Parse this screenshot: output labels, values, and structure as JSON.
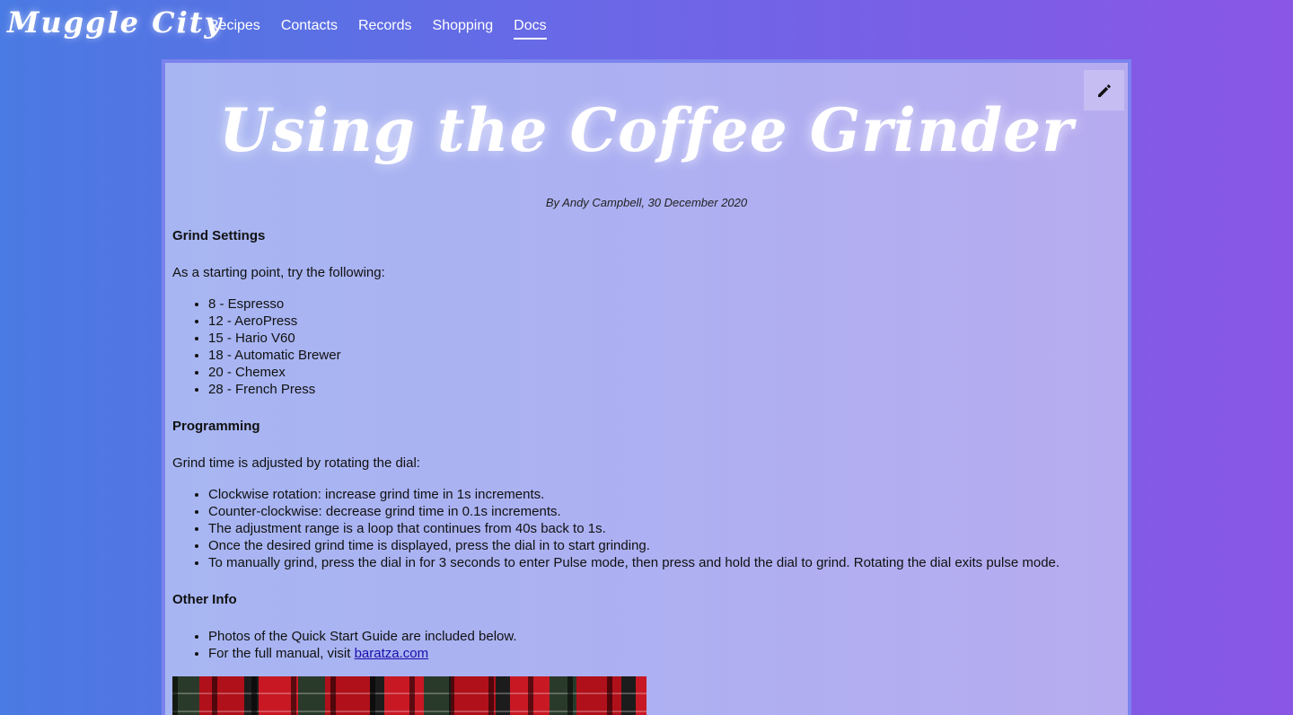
{
  "brand": "Muggle City",
  "nav": {
    "items": [
      "Recipes",
      "Contacts",
      "Records",
      "Shopping",
      "Docs"
    ],
    "active": "Docs"
  },
  "doc": {
    "title": "Using the Coffee Grinder",
    "byline": "By Andy Campbell, 30 December 2020",
    "edit_icon": "pencil-icon",
    "sections": {
      "grind": {
        "heading": "Grind Settings",
        "intro": "As a starting point, try the following:",
        "items": [
          "8 - Espresso",
          "12 - AeroPress",
          "15 - Hario V60",
          "18 - Automatic Brewer",
          "20 - Chemex",
          "28 - French Press"
        ]
      },
      "programming": {
        "heading": "Programming",
        "intro": "Grind time is adjusted by rotating the dial:",
        "items": [
          "Clockwise rotation: increase grind time in 1s increments.",
          "Counter-clockwise: decrease grind time in 0.1s increments.",
          "The adjustment range is a loop that continues from 40s back to 1s.",
          "Once the desired grind time is displayed, press the dial in to start grinding.",
          "To manually grind, press the dial in for 3 seconds to enter Pulse mode, then press and hold the dial to grind. Rotating the dial exits pulse mode."
        ]
      },
      "other": {
        "heading": "Other Info",
        "item1": "Photos of the Quick Start Guide are included below.",
        "item2_prefix": "For the full manual, visit ",
        "item2_link": "baratza.com"
      }
    }
  },
  "colors": {
    "bg_left": "#4a7ae3",
    "bg_right": "#8a56e6",
    "link": "#1a0dab"
  }
}
